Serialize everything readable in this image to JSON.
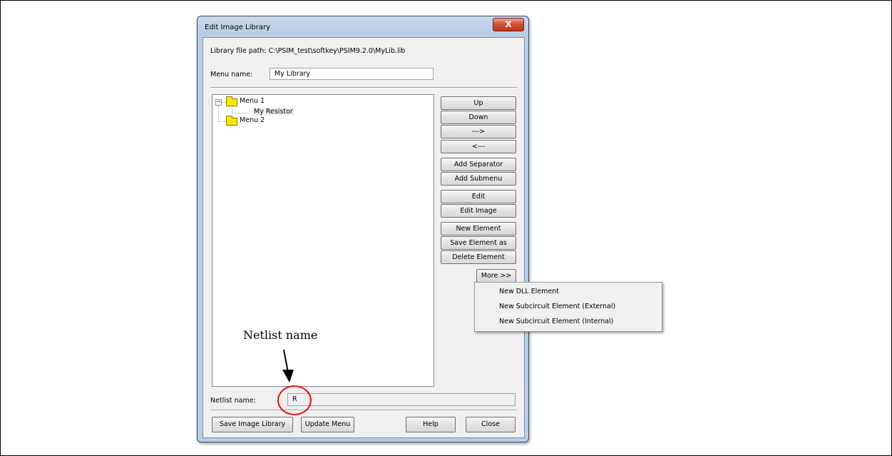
{
  "window": {
    "title": "Edit Image Library",
    "close_glyph": "X"
  },
  "library": {
    "path_label": "Library file path: C:\\PSIM_test\\softkey\\PSIM9.2.0\\MyLib.lib"
  },
  "menu_name": {
    "label": "Menu name:",
    "value": "My Library"
  },
  "tree": {
    "items": [
      {
        "label": "Menu 1",
        "icon": "folder-icon",
        "expander": "−"
      },
      {
        "label": "My Resistor"
      },
      {
        "label": "Menu 2",
        "icon": "folder-icon"
      }
    ]
  },
  "buttons": {
    "up": "Up",
    "down": "Down",
    "right": "--->",
    "left": "<---",
    "add_separator": "Add Separator",
    "add_submenu": "Add Submenu",
    "edit": "Edit",
    "edit_image": "Edit Image",
    "new_element": "New Element",
    "save_element_as": "Save Element as",
    "delete_element": "Delete Element",
    "more": "More  >>"
  },
  "more_menu": [
    "New DLL Element",
    "New Subcircuit Element (External)",
    "New Subcircuit Element (Internal)"
  ],
  "netlist": {
    "label": "Netlist name:",
    "value": "R"
  },
  "footer": {
    "save_library": "Save Image Library",
    "update_menu": "Update Menu",
    "help": "Help",
    "close": "Close"
  },
  "annotation": {
    "text": "Netlist name",
    "highlight_color": "#e01818"
  }
}
